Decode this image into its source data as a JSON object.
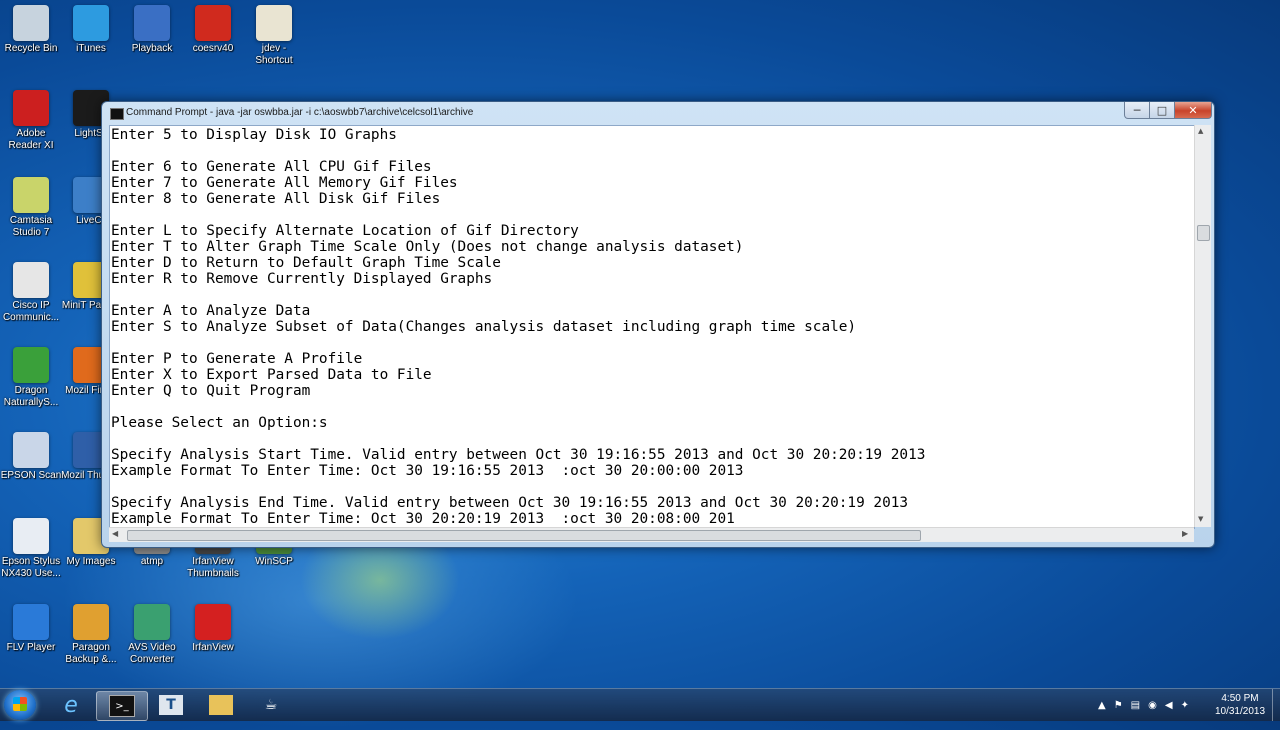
{
  "desktop": {
    "icons": [
      {
        "label": "Recycle Bin",
        "icon": "recycle-bin-icon",
        "color": "#c7d3de"
      },
      {
        "label": "iTunes",
        "icon": "itunes-icon",
        "color": "#2d9be0"
      },
      {
        "label": "Playback",
        "icon": "playback-icon",
        "color": "#3a6fc4"
      },
      {
        "label": "coesrv40",
        "icon": "coesrv40-icon",
        "color": "#d02a1e"
      },
      {
        "label": "jdev - Shortcut",
        "icon": "java-cup-icon",
        "color": "#e9e4d2"
      },
      {
        "label": "Adobe Reader XI",
        "icon": "adobe-reader-icon",
        "color": "#cc1f1f"
      },
      {
        "label": "LightSc",
        "icon": "lightscribe-icon",
        "color": "#1b1b1b"
      },
      {
        "label": "Camtasia Studio 7",
        "icon": "camtasia-icon",
        "color": "#c9d46a"
      },
      {
        "label": "LiveCli",
        "icon": "livecli-icon",
        "color": "#3d7fc8"
      },
      {
        "label": "Cisco IP Communic...",
        "icon": "cisco-ip-icon",
        "color": "#e6e6e6"
      },
      {
        "label": "MiniT Partitio",
        "icon": "minitool-icon",
        "color": "#e0c13a"
      },
      {
        "label": "Dragon NaturallyS...",
        "icon": "dragon-icon",
        "color": "#3aa03a"
      },
      {
        "label": "Mozil Firefo",
        "icon": "firefox-icon",
        "color": "#e06a1c"
      },
      {
        "label": "EPSON Scan",
        "icon": "epson-scan-icon",
        "color": "#c9d6e8"
      },
      {
        "label": "Mozil Thunde",
        "icon": "thunderbird-icon",
        "color": "#2f5fa8"
      },
      {
        "label": "Epson Stylus NX430 Use...",
        "icon": "epson-stylus-icon",
        "color": "#e8edf3"
      },
      {
        "label": "My Images",
        "icon": "my-images-icon",
        "color": "#e3c86a"
      },
      {
        "label": "atmp",
        "icon": "atmp-icon",
        "color": "#888888"
      },
      {
        "label": "IrfanView Thumbnails",
        "icon": "irfanview-thumbnails-icon",
        "color": "#444444"
      },
      {
        "label": "WinSCP",
        "icon": "winscp-icon",
        "color": "#4a8a3a"
      },
      {
        "label": "FLV Player",
        "icon": "flv-player-icon",
        "color": "#2a7ad8"
      },
      {
        "label": "Paragon Backup &...",
        "icon": "paragon-icon",
        "color": "#e0a030"
      },
      {
        "label": "AVS Video Converter",
        "icon": "avs-video-icon",
        "color": "#3aa070"
      },
      {
        "label": "IrfanView",
        "icon": "irfanview-icon",
        "color": "#d42020"
      }
    ]
  },
  "window": {
    "title": "Command Prompt - java  -jar oswbba.jar -i c:\\aoswbb7\\archive\\celcsol1\\archive",
    "min_label": "─",
    "max_label": "□",
    "close_label": "✕",
    "lines": [
      "Enter 5 to Display Disk IO Graphs",
      "",
      "Enter 6 to Generate All CPU Gif Files",
      "Enter 7 to Generate All Memory Gif Files",
      "Enter 8 to Generate All Disk Gif Files",
      "",
      "Enter L to Specify Alternate Location of Gif Directory",
      "Enter T to Alter Graph Time Scale Only (Does not change analysis dataset)",
      "Enter D to Return to Default Graph Time Scale",
      "Enter R to Remove Currently Displayed Graphs",
      "",
      "Enter A to Analyze Data",
      "Enter S to Analyze Subset of Data(Changes analysis dataset including graph time scale)",
      "",
      "Enter P to Generate A Profile",
      "Enter X to Export Parsed Data to File",
      "Enter Q to Quit Program",
      "",
      "Please Select an Option:s",
      "",
      "Specify Analysis Start Time. Valid entry between Oct 30 19:16:55 2013 and Oct 30 20:20:19 2013",
      "Example Format To Enter Time: Oct 30 19:16:55 2013  :oct 30 20:00:00 2013",
      "",
      "Specify Analysis End Time. Valid entry between Oct 30 19:16:55 2013 and Oct 30 20:20:19 2013",
      "Example Format To Enter Time: Oct 30 20:20:19 2013  :oct 30 20:08:00 201"
    ]
  },
  "taskbar": {
    "items": [
      {
        "icon": "ie-icon",
        "glyph": "e"
      },
      {
        "icon": "command-prompt-icon",
        "glyph": ">_"
      },
      {
        "icon": "text-editor-icon",
        "glyph": "T"
      },
      {
        "icon": "folder-icon",
        "glyph": "▭"
      },
      {
        "icon": "java-icon",
        "glyph": "☕"
      }
    ],
    "clock_time": "4:50 PM",
    "clock_date": "10/31/2013",
    "tray_arrow": "▲"
  }
}
